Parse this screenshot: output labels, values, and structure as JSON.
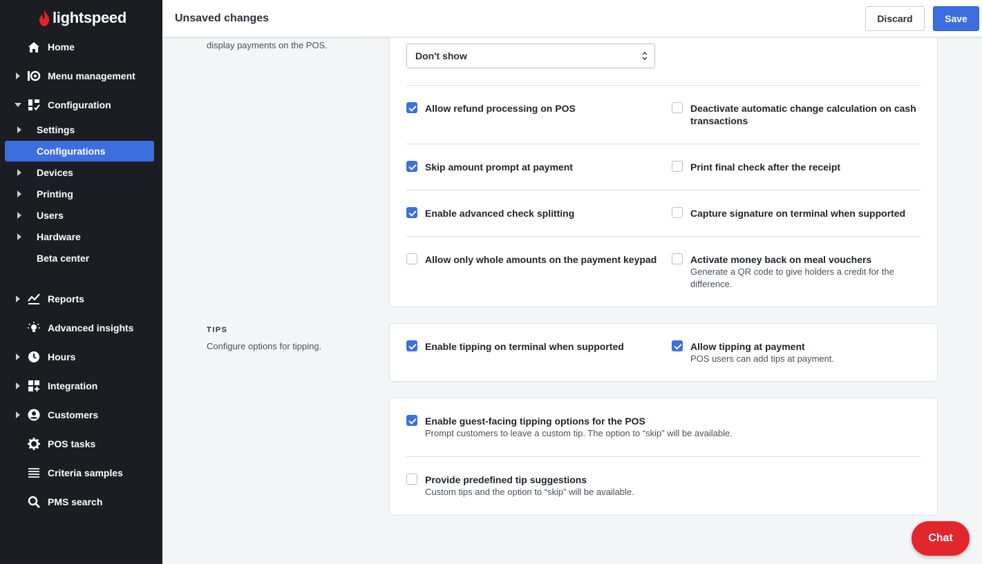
{
  "brand": {
    "name": "lightspeed",
    "accent": "#3d6ee0",
    "logo_red": "#e3262b"
  },
  "sidebar": {
    "items": [
      {
        "label": "Home",
        "icon": "home-icon"
      },
      {
        "label": "Menu management",
        "icon": "menu-management-icon"
      },
      {
        "label": "Configuration",
        "icon": "configuration-icon"
      },
      {
        "label": "Reports",
        "icon": "reports-icon"
      },
      {
        "label": "Advanced insights",
        "icon": "insights-icon"
      },
      {
        "label": "Hours",
        "icon": "clock-icon"
      },
      {
        "label": "Integration",
        "icon": "integration-icon"
      },
      {
        "label": "Customers",
        "icon": "customers-icon"
      },
      {
        "label": "POS tasks",
        "icon": "gear-icon"
      },
      {
        "label": "Criteria samples",
        "icon": "list-icon"
      },
      {
        "label": "PMS search",
        "icon": "search-icon"
      }
    ],
    "sub_items": [
      {
        "label": "Settings"
      },
      {
        "label": "Configurations"
      },
      {
        "label": "Devices"
      },
      {
        "label": "Printing"
      },
      {
        "label": "Users"
      },
      {
        "label": "Hardware"
      },
      {
        "label": "Beta center"
      }
    ]
  },
  "header": {
    "title": "Unsaved changes",
    "discard_label": "Discard",
    "save_label": "Save"
  },
  "payments": {
    "desc_partial": "display payments on the POS.",
    "select_value": "Don't show",
    "options": [
      {
        "label": "Allow refund processing on POS",
        "checked": true
      },
      {
        "label": "Deactivate automatic change calculation on cash transactions",
        "checked": false
      },
      {
        "label": "Skip amount prompt at payment",
        "checked": true
      },
      {
        "label": "Print final check after the receipt",
        "checked": false
      },
      {
        "label": "Enable advanced check splitting",
        "checked": true
      },
      {
        "label": "Capture signature on terminal when supported",
        "checked": false
      },
      {
        "label": "Allow only whole amounts on the payment keypad",
        "checked": false
      },
      {
        "label": "Activate money back on meal vouchers",
        "checked": false,
        "sub": "Generate a QR code to give holders a credit for the difference."
      }
    ]
  },
  "tips": {
    "title": "TIPS",
    "desc": "Configure options for tipping.",
    "options": [
      {
        "label": "Enable tipping on terminal when supported",
        "checked": true
      },
      {
        "label": "Allow tipping at payment",
        "checked": true,
        "sub": "POS users can add tips at payment."
      }
    ],
    "guest_options": [
      {
        "label": "Enable guest-facing tipping options for the POS",
        "checked": true,
        "sub": "Prompt customers to leave a custom tip. The option to “skip” will be available."
      },
      {
        "label": "Provide predefined tip suggestions",
        "checked": false,
        "sub": "Custom tips and the option to “skip” will be available."
      }
    ]
  },
  "chat": {
    "label": "Chat"
  }
}
